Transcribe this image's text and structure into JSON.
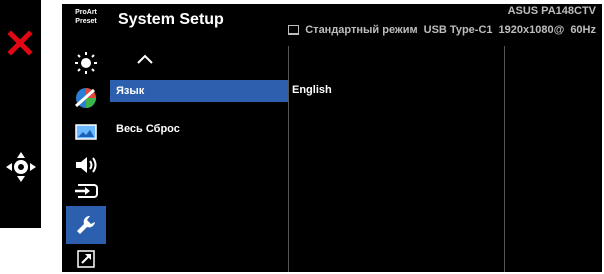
{
  "osd": {
    "title": "System Setup",
    "model": "ASUS PA148CTV",
    "status": {
      "mode": "Стандартный режим",
      "input": "USB Type-C1",
      "resolution": "1920x1080@",
      "refresh": "60Hz"
    },
    "preset_label": [
      "ProArt",
      "Preset"
    ],
    "icons": [
      {
        "name": "brightness-icon"
      },
      {
        "name": "color-icon"
      },
      {
        "name": "image-icon"
      },
      {
        "name": "sound-icon"
      },
      {
        "name": "input-select-icon"
      },
      {
        "name": "system-setup-icon",
        "active": true
      },
      {
        "name": "shortcut-icon"
      }
    ],
    "menu_items": [
      "Язык",
      "Весь Сброс"
    ],
    "selected_item": "Язык",
    "selected_value": "English"
  },
  "keys": {
    "exit_icon": "close-icon",
    "nav_icon": "five-way-navigation-icon"
  },
  "colors": {
    "highlight": "#2c5fae",
    "exit_red": "#e30613",
    "background": "#000000"
  }
}
